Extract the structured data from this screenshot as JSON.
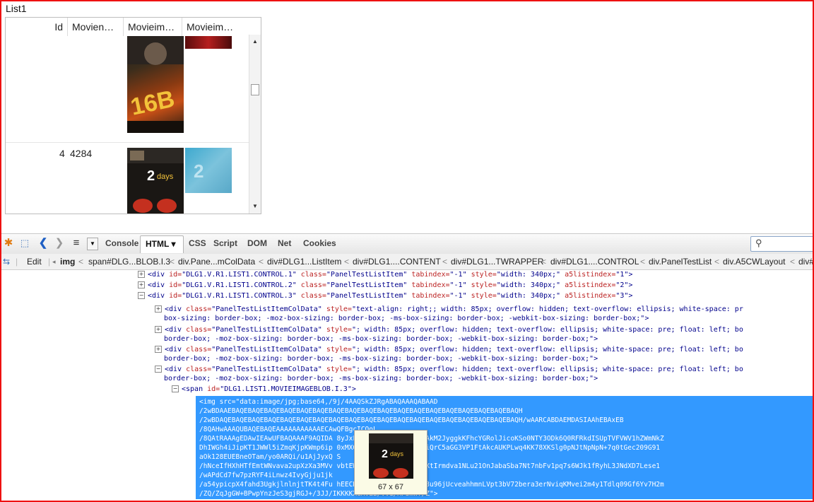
{
  "list": {
    "title": "List1",
    "columns": [
      "Id",
      "Moviena…",
      "Movieim…",
      "Movieim…"
    ],
    "rows": [
      {
        "id": "",
        "name": ""
      },
      {
        "id": "4",
        "name": "4284"
      }
    ]
  },
  "firebug": {
    "tabs": [
      "Console",
      "HTML ▾",
      "CSS",
      "Script",
      "DOM",
      "Net",
      "Cookies"
    ],
    "edit_label": "Edit",
    "breadcrumb": [
      "img",
      "span#DLG...BLOB.I.3",
      "div.Pane...mColData",
      "div#DLG1...ListItem",
      "div#DLG1....CONTENT",
      "div#DLG1...TWRAPPER",
      "div#DLG1....CONTROL",
      "div.PanelTestList",
      "div.A5CWLayout",
      "div#"
    ],
    "icons": {
      "toggle_collapsed": "⊞",
      "toggle_expanded": "⊟"
    }
  },
  "html_panel": {
    "lines": [
      {
        "toggle": "⊞",
        "tag": "div",
        "attrs": [
          [
            "id",
            "\"DLG1.V.R1.LIST1.CONTROL.1\""
          ],
          [
            "class",
            "\"PanelTestListItem\""
          ],
          [
            "tabindex",
            "\"-1\""
          ],
          [
            "style",
            "\"width: 340px;\""
          ],
          [
            "a5listindex",
            "\"1\""
          ]
        ],
        "end": ">"
      },
      {
        "toggle": "⊞",
        "tag": "div",
        "attrs": [
          [
            "id",
            "\"DLG1.V.R1.LIST1.CONTROL.2\""
          ],
          [
            "class",
            "\"PanelTestListItem\""
          ],
          [
            "tabindex",
            "\"-1\""
          ],
          [
            "style",
            "\"width: 340px;\""
          ],
          [
            "a5listindex",
            "\"2\""
          ]
        ],
        "end": ">"
      },
      {
        "toggle": "⊟",
        "tag": "div",
        "attrs": [
          [
            "id",
            "\"DLG1.V.R1.LIST1.CONTROL.3\""
          ],
          [
            "class",
            "\"PanelTestListItem\""
          ],
          [
            "tabindex",
            "\"-1\""
          ],
          [
            "style",
            "\"width: 340px;\""
          ],
          [
            "a5listindex",
            "\"3\""
          ]
        ],
        "end": ">"
      },
      {
        "toggle": "⊞",
        "tag": "div",
        "attrs": [
          [
            "class",
            "\"PanelTestListItemColData\""
          ],
          [
            "style",
            "\"text-align: right;; width: 85px; overflow: hidden; text-overflow: ellipsis; white-space: pr"
          ]
        ],
        "end": ""
      },
      {
        "toggle": "",
        "cont": "box-sizing: border-box; -moz-box-sizing: border-box; -ms-box-sizing: border-box; -webkit-box-sizing: border-box;\">"
      },
      {
        "toggle": "⊞",
        "tag": "div",
        "attrs": [
          [
            "class",
            "\"PanelTestListItemColData\""
          ],
          [
            "style",
            "\"; width: 85px; overflow: hidden; text-overflow: ellipsis; white-space: pre; float: left; bo"
          ]
        ],
        "end": ""
      },
      {
        "toggle": "",
        "cont": "border-box; -moz-box-sizing: border-box; -ms-box-sizing: border-box; -webkit-box-sizing: border-box;\">"
      },
      {
        "toggle": "⊞",
        "tag": "div",
        "attrs": [
          [
            "class",
            "\"PanelTestListItemColData\""
          ],
          [
            "style",
            "\"; width: 85px; overflow: hidden; text-overflow: ellipsis; white-space: pre; float: left; bo"
          ]
        ],
        "end": ""
      },
      {
        "toggle": "",
        "cont": "border-box; -moz-box-sizing: border-box; -ms-box-sizing: border-box; -webkit-box-sizing: border-box;\">"
      },
      {
        "toggle": "⊟",
        "tag": "div",
        "attrs": [
          [
            "class",
            "\"PanelTestListItemColData\""
          ],
          [
            "style",
            "\"; width: 85px; overflow: hidden; text-overflow: ellipsis; white-space: pre; float: left; bo"
          ]
        ],
        "end": ""
      },
      {
        "toggle": "",
        "cont": "border-box; -moz-box-sizing: border-box; -ms-box-sizing: border-box; -webkit-box-sizing: border-box;\">"
      },
      {
        "toggle": "⊟",
        "tag": "span",
        "attrs": [
          [
            "id",
            "\"DLG1.LIST1.MOVIEIMAGEBLOB.I.3\""
          ]
        ],
        "end": ">"
      }
    ],
    "selected_lines": [
      "<img src=\"data:image/jpg;base64,/9j/4AAQSkZJRgABAQAAAQABAAD",
      "/2wBDAAEBAQEBAQEBAQEBAQEBAQEBAQEBAQEBAQEBAQEBAQEBAQEBAQEBAQEBAQEBAQEBAQEBAQEBAQH",
      "/2wBDAQEBAQEBAQEBAQEBAQEBAQEBAQEBAQEBAQEBAQEBAQEBAQEBAQEBAQEBAQEBAQEBAQEBAQEBAQH/wAARCABDAEMDASIAAhEBAxEB",
      "/8QAHwAAAQUBAQEBAQEAAAAAAAAAAAECAwQFBgcICQoL",
      "/8QAtRAAAgEDAwIEAwUFBAQAAAF9AQIDA                 8yJxFDKBkaEII0KxwRVS0fAkM2JyggkKFhcYGRolJicoKSo0NTY3ODk6Q0RFRkdISUpTVFVWV1hZWmNkZ",
      "DhIWGh4iJipKT1JWWl5iZmqKjpKWmp6ip                 0xMXGx8jJytLT...Y5I0uQiQrC5aGG3VP1FtAkcAUKPLwq4KK78XKSlg0pNJtNpNpN+7q0tGec209G91",
      "aOk128EUEBneOTam/yo0ARQi/u1AjJyxQ                 S",
      "/hNceIfHXhHTfEmtWNvava2upXzXa3MVv                 vbtEWRXCC5mK4Z2JKK48ZKXtIrmdva1NLu21OnJabaSba7Nt7nbFv1pq7s6WJk1fRyhL3JNdXD7Lese1",
      "/wAPdCd7fw7pzRYF4iLnwz4IvyGjju1jk",
      "/a54ypicpX4fahd3UgkjlnlnjtTK4t4Fu                 hEECRokUP+rjRQqqFGKKK58u96jUcveahhmnLVpt3bV72bera3erNviqKMvei2m4y1Tdlq09Gf6Yv7H2m",
      "/ZQ/ZqJgGW+BPwpYnzJeS3gjRGJ+/3JJ/IKKKKXdXvLz/VV1/APSmWf/Z\">"
    ]
  },
  "tooltip": {
    "dimensions": "67 x 67"
  }
}
